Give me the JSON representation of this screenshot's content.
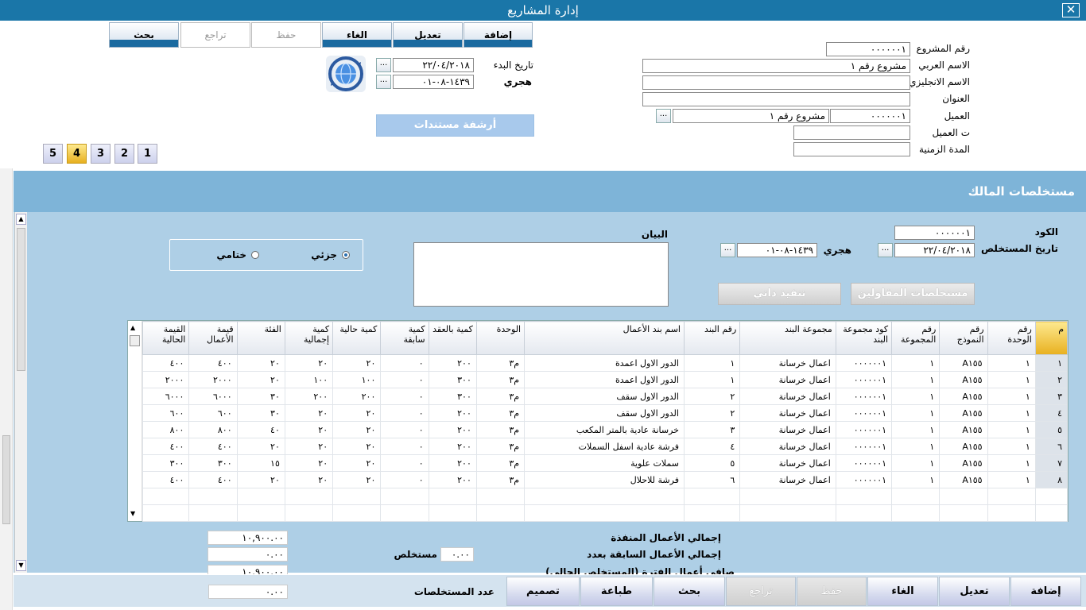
{
  "window": {
    "title": "إدارة المشاريع",
    "close_icon": "close-icon"
  },
  "toolbar": {
    "add": "إضافة",
    "edit": "تعديل",
    "cancel": "الغاء",
    "save": "حفظ",
    "undo": "تراجع",
    "search": "بحث"
  },
  "project": {
    "number_label": "رقم المشروع",
    "number": "٠٠٠٠٠٠١",
    "arabic_name_label": "الاسم العربي",
    "arabic_name": "مشروع رقم ١",
    "english_name_label": "الاسم الانجليزي",
    "english_name": "",
    "address_label": "العنوان",
    "address": "",
    "client_label": "العميل",
    "client_code": "٠٠٠٠٠٠١",
    "client_name": "مشروع رقم ١",
    "client_phone_label": "ت العميل",
    "client_phone": "",
    "duration_label": "المدة الزمنية",
    "duration": "",
    "start_date_label": "تاريخ البدء",
    "start_date": "٢٢/٠٤/٢٠١٨",
    "hijri_label": "هجري",
    "hijri_date": "١٤٣٩-٠٨-٠١",
    "archive_button": "أرشفة مستندات",
    "dots": "..."
  },
  "pages": [
    "1",
    "2",
    "3",
    "4",
    "5"
  ],
  "active_page": "4",
  "section": {
    "title": "مستخلصات المالك"
  },
  "extract": {
    "code_label": "الكود",
    "code": "٠٠٠٠٠٠١",
    "date_label": "تاريخ المستخلص",
    "date": "٢٢/٠٤/٢٠١٨",
    "hijri_label": "هجري",
    "hijri_date": "١٤٣٩-٠٨-٠١",
    "statement_label": "البيان",
    "statement": "",
    "partial_label": "جزئي",
    "final_label": "ختامي",
    "contractors_button": "مستخلصات المقاولين",
    "self_exec_button": "تنفيذ ذاتي"
  },
  "grid": {
    "headers": [
      "م",
      "رقم الوحدة",
      "رقم النموذج",
      "رقم المجموعة",
      "كود مجموعة البند",
      "مجموعة البند",
      "رقم البند",
      "اسم بند الأعمال",
      "الوحدة",
      "كمية بالعقد",
      "كمية سابقة",
      "كمية حالية",
      "كمية إجمالية",
      "الفئة",
      "قيمة الأعمال",
      "القيمة الحالية"
    ],
    "rows": [
      [
        "١",
        "١",
        "A١٥٥",
        "١",
        "٠٠٠٠٠٠١",
        "اعمال خرسانة",
        "١",
        "الدور الاول اعمدة",
        "م٣",
        "٢٠٠",
        "٠",
        "٢٠",
        "٢٠",
        "٢٠",
        "٤٠٠",
        "٤٠٠"
      ],
      [
        "٢",
        "١",
        "A١٥٥",
        "١",
        "٠٠٠٠٠٠١",
        "اعمال خرسانة",
        "١",
        "الدور الاول اعمدة",
        "م٣",
        "٣٠٠",
        "٠",
        "١٠٠",
        "١٠٠",
        "٢٠",
        "٢٠٠٠",
        "٢٠٠٠"
      ],
      [
        "٣",
        "١",
        "A١٥٥",
        "١",
        "٠٠٠٠٠٠١",
        "اعمال خرسانة",
        "٢",
        "الدور الاول سقف",
        "م٣",
        "٣٠٠",
        "٠",
        "٢٠٠",
        "٢٠٠",
        "٣٠",
        "٦٠٠٠",
        "٦٠٠٠"
      ],
      [
        "٤",
        "١",
        "A١٥٥",
        "١",
        "٠٠٠٠٠٠١",
        "اعمال خرسانة",
        "٢",
        "الدور الاول سقف",
        "م٣",
        "٢٠٠",
        "٠",
        "٢٠",
        "٢٠",
        "٣٠",
        "٦٠٠",
        "٦٠٠"
      ],
      [
        "٥",
        "١",
        "A١٥٥",
        "١",
        "٠٠٠٠٠٠١",
        "اعمال خرسانة",
        "٣",
        "خرسانة عادية بالمتر المكعب",
        "م٣",
        "٢٠٠",
        "٠",
        "٢٠",
        "٢٠",
        "٤٠",
        "٨٠٠",
        "٨٠٠"
      ],
      [
        "٦",
        "١",
        "A١٥٥",
        "١",
        "٠٠٠٠٠٠١",
        "اعمال خرسانة",
        "٤",
        "فرشة عادية اسفل السملات",
        "م٣",
        "٢٠٠",
        "٠",
        "٢٠",
        "٢٠",
        "٢٠",
        "٤٠٠",
        "٤٠٠"
      ],
      [
        "٧",
        "١",
        "A١٥٥",
        "١",
        "٠٠٠٠٠٠١",
        "اعمال خرسانة",
        "٥",
        "سملات علوية",
        "م٣",
        "٢٠٠",
        "٠",
        "٢٠",
        "٢٠",
        "١٥",
        "٣٠٠",
        "٣٠٠"
      ],
      [
        "٨",
        "١",
        "A١٥٥",
        "١",
        "٠٠٠٠٠٠١",
        "اعمال خرسانة",
        "٦",
        "فرشة للاحلال",
        "م٣",
        "٢٠٠",
        "٠",
        "٢٠",
        "٢٠",
        "٢٠",
        "٤٠٠",
        "٤٠٠"
      ]
    ]
  },
  "totals": {
    "executed_label": "إجمالي الأعمال المنفذة",
    "executed": "١٠,٩٠٠.٠٠",
    "previous_label": "إجمالي الأعمال السابقة بعدد",
    "previous": "٠.٠٠",
    "previous_count_label": "مستخلص",
    "previous_count": "٠.٠٠",
    "net_label": "صافي أعمال الفترة (المستخلص الحالي)",
    "net": "١٠,٩٠٠.٠٠",
    "count_label": "عدد المستخلصات",
    "count": "٠.٠٠"
  },
  "bottom": {
    "add": "إضافة",
    "edit": "تعديل",
    "cancel": "الغاء",
    "save": "حفظ",
    "undo": "تراجع",
    "search": "بحث",
    "print": "طباعة",
    "design": "تصميم"
  }
}
